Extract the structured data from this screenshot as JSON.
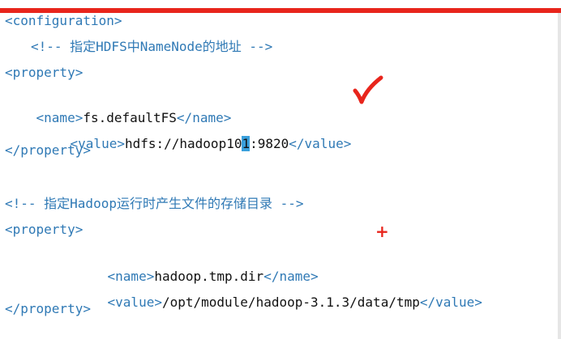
{
  "editor": {
    "line1": {
      "tag": "<configuration>"
    },
    "line2": {
      "comment": "<!-- 指定HDFS中NameNode的地址 -->"
    },
    "line3": {
      "tag": "<property>"
    },
    "line4": {
      "open": "<name>",
      "text": "fs.defaultFS",
      "close": "</name>"
    },
    "line5": {
      "open": "<value>",
      "text_before": "hdfs://hadoop10",
      "cursor_char": "1",
      "text_after": ":9820",
      "close": "</value>"
    },
    "line6": {
      "tag": "</property>"
    },
    "line8": {
      "comment": "<!-- 指定Hadoop运行时产生文件的存储目录 -->"
    },
    "line9": {
      "tag": "<property>"
    },
    "line10": {
      "open": "<name>",
      "text": "hadoop.tmp.dir",
      "close": "</name>"
    },
    "line11": {
      "open": "<value>",
      "text": "/opt/module/hadoop-3.1.3/data/tmp",
      "close": "</value>"
    },
    "line12": {
      "tag": "</property>"
    }
  },
  "annotations": {
    "checkmark": "checkmark",
    "plus": "+",
    "accent_color": "#e8251c",
    "tag_color": "#2f79b5",
    "cursor_color": "#3aa0dc"
  }
}
